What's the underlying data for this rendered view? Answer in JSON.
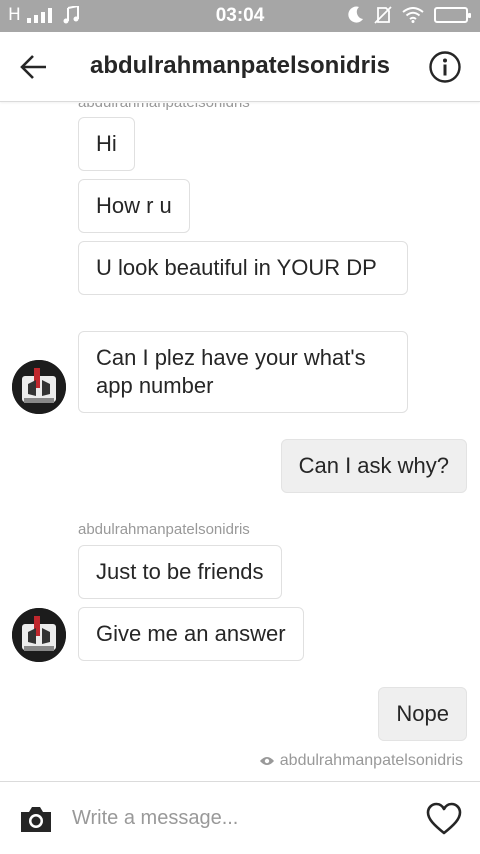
{
  "status_bar": {
    "carrier_text": "H",
    "time": "03:04",
    "icons": [
      "signal-icon",
      "music-icon",
      "moon-icon",
      "no-sim-icon",
      "wifi-icon",
      "battery-icon"
    ]
  },
  "header": {
    "title": "abdulrahmanpatelsonidris",
    "back_icon": "arrow-left-icon",
    "info_icon": "info-icon"
  },
  "chat": {
    "top_sender_name": "abdulrahmanpatelsonidris",
    "group1": [
      "Hi",
      "How r u",
      "U look beautiful in YOUR DP",
      "Can I plez have your what's app number"
    ],
    "out1": "Can I ask why?",
    "group2_sender_name": "abdulrahmanpatelsonidris",
    "group2": [
      "Just to be friends",
      "Give me an answer"
    ],
    "out2": "Nope",
    "seen_by": "abdulrahmanpatelsonidris"
  },
  "composer": {
    "placeholder": "Write a message...",
    "camera_icon": "camera-icon",
    "heart_icon": "heart-icon"
  },
  "colors": {
    "status_bar_bg": "#a6a6a6",
    "outgoing_bubble_bg": "#efefef",
    "meta_text": "#999999"
  }
}
